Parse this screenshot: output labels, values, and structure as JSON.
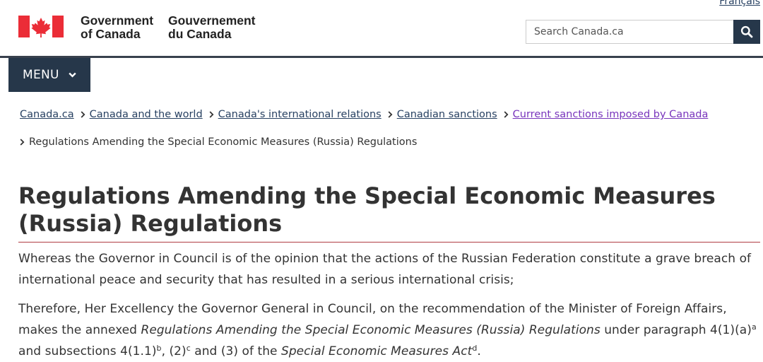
{
  "header": {
    "language_link": "Français",
    "gov_name_en_line1": "Government",
    "gov_name_en_line2": "of Canada",
    "gov_name_fr_line1": "Gouvernement",
    "gov_name_fr_line2": "du Canada",
    "search_placeholder": "Search Canada.ca",
    "search_icon": "search-icon",
    "menu_label": "MENU",
    "menu_icon": "chevron-down-icon",
    "flag_color": "#eb2d37",
    "bar_color": "#26374a"
  },
  "breadcrumb": {
    "items": [
      "Canada.ca",
      "Canada and the world",
      "Canada's international relations",
      "Canadian sanctions",
      "Current sanctions imposed by Canada"
    ],
    "current": "Regulations Amending the Special Economic Measures (Russia) Regulations"
  },
  "main": {
    "title": "Regulations Amending the Special Economic Measures (Russia) Regulations",
    "paragraph1": "Whereas the Governor in Council is of the opinion that the actions of the Russian Federation constitute a grave breach of international peace and security that has resulted in a serious international crisis;",
    "paragraph2": {
      "t1": "Therefore, Her Excellency the Governor General in Council, on the recommendation of the Minister of Foreign Affairs, makes the annexed ",
      "i1": "Regulations Amending the Special Economic Measures (Russia) Regulations",
      "t2": " under paragraph 4(1)(a)",
      "s1": "a",
      "t3": " and subsections 4(1.1)",
      "s2": "b",
      "t4": ", (2)",
      "s3": "c",
      "t5": " and (3) of the ",
      "i2": "Special Economic Measures Act",
      "s4": "d",
      "t6": "."
    }
  }
}
